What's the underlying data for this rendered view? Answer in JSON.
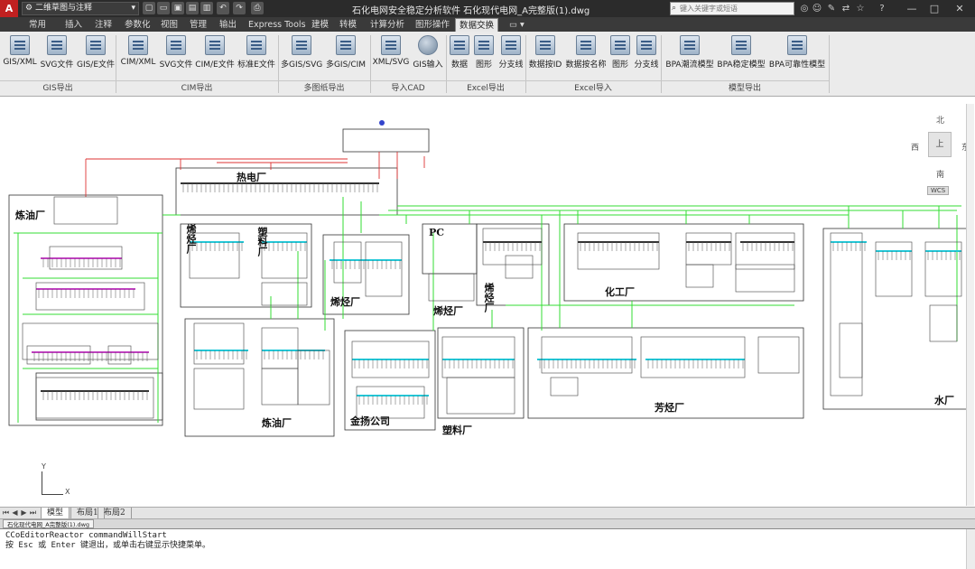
{
  "titlebar": {
    "app_logo": "A",
    "workspace": "二维草图与注释",
    "title": "石化电网安全稳定分析软件    石化现代电网_A完整版(1).dwg",
    "search_placeholder": "键入关键字或短语",
    "quick_access_icons": [
      "new-file-icon",
      "open-folder-icon",
      "save-icon",
      "save-as-icon",
      "print-preview-icon",
      "undo-icon",
      "redo-icon",
      "print-icon"
    ],
    "right_icons": [
      "binoculars-icon",
      "user-icon",
      "exchange-icon",
      "wrench-icon",
      "star-icon",
      "help-icon"
    ],
    "window_buttons": {
      "minimize": "—",
      "restore": "□",
      "close": "✕"
    }
  },
  "tabs": [
    "常用",
    "插入",
    "注释",
    "参数化",
    "视图",
    "管理",
    "输出",
    "Express Tools",
    "建模",
    "转模",
    "计算分析",
    "图形操作",
    "数据交换"
  ],
  "active_tab": "数据交换",
  "ribbon": {
    "groups": [
      {
        "name": "GIS导出",
        "buttons": [
          "GIS/XML",
          "SVG文件",
          "GIS/E文件"
        ]
      },
      {
        "name": "CIM导出",
        "buttons": [
          "CIM/XML",
          "SVG文件",
          "CIM/E文件",
          "标准E文件"
        ]
      },
      {
        "name": "多图纸导出",
        "buttons": [
          "多GIS/SVG",
          "多GIS/CIM"
        ]
      },
      {
        "name": "导入CAD",
        "buttons": [
          "XML/SVG",
          "GIS输入"
        ]
      },
      {
        "name": "Excel导出",
        "buttons": [
          "数据",
          "图形",
          "分支线"
        ]
      },
      {
        "name": "Excel导入",
        "buttons": [
          "数据按ID",
          "数据按名称",
          "图形",
          "分支线"
        ]
      },
      {
        "name": "模型导出",
        "buttons": [
          "BPA潮流模型",
          "BPA稳定模型",
          "BPA可靠性模型"
        ]
      }
    ]
  },
  "drawing": {
    "plant_labels": [
      "热电厂",
      "炼油厂",
      "烯烃厂",
      "塑料厂",
      "烯烃厂",
      "烯烃厂",
      "烯烃厂",
      "化工厂",
      "炼油厂",
      "金扬公司",
      "塑料厂",
      "芳烃厂",
      "水厂",
      "PC"
    ],
    "colors": {
      "feeder_green": "#33dd33",
      "cable_red": "#dd3333",
      "busbar_cyan": "#22c8d8",
      "busbar_magenta": "#c040c0",
      "frame": "#333333"
    }
  },
  "viewcube": {
    "north": "北",
    "south": "南",
    "west": "西",
    "east": "东",
    "top": "上",
    "wcs": "WCS"
  },
  "ucs": {
    "x": "X",
    "y": "Y"
  },
  "layout_tabs": [
    "模型",
    "布局1",
    "布局2"
  ],
  "active_layout": "模型",
  "file_tab": "石化现代电网_A完整版(1).dwg",
  "command_line": [
    "CCoEditorReactor commandWillStart",
    "按 Esc 或 Enter 键退出，或单击右键显示快捷菜单。"
  ]
}
